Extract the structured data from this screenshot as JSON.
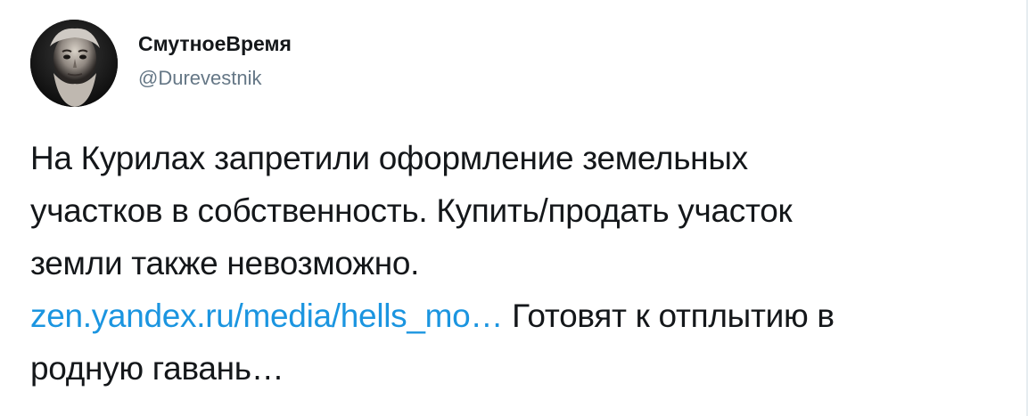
{
  "author": {
    "display_name": "СмутноеВремя",
    "handle": "@Durevestnik",
    "avatar_icon": "bearded-man-portrait-avatar"
  },
  "tweet": {
    "line_1": "На Курилах запретили оформление земельных",
    "line_2": "участков в собственность. Купить/продать участок",
    "line_3": "земли также невозможно.",
    "link_text": "zen.yandex.ru/media/hells_mo…",
    "line_4_rest": " Готовят к отплытию в",
    "line_5": "родную гавань…"
  },
  "colors": {
    "text": "#14171a",
    "secondary": "#657786",
    "link": "#1b95e0",
    "background": "#ffffff"
  }
}
